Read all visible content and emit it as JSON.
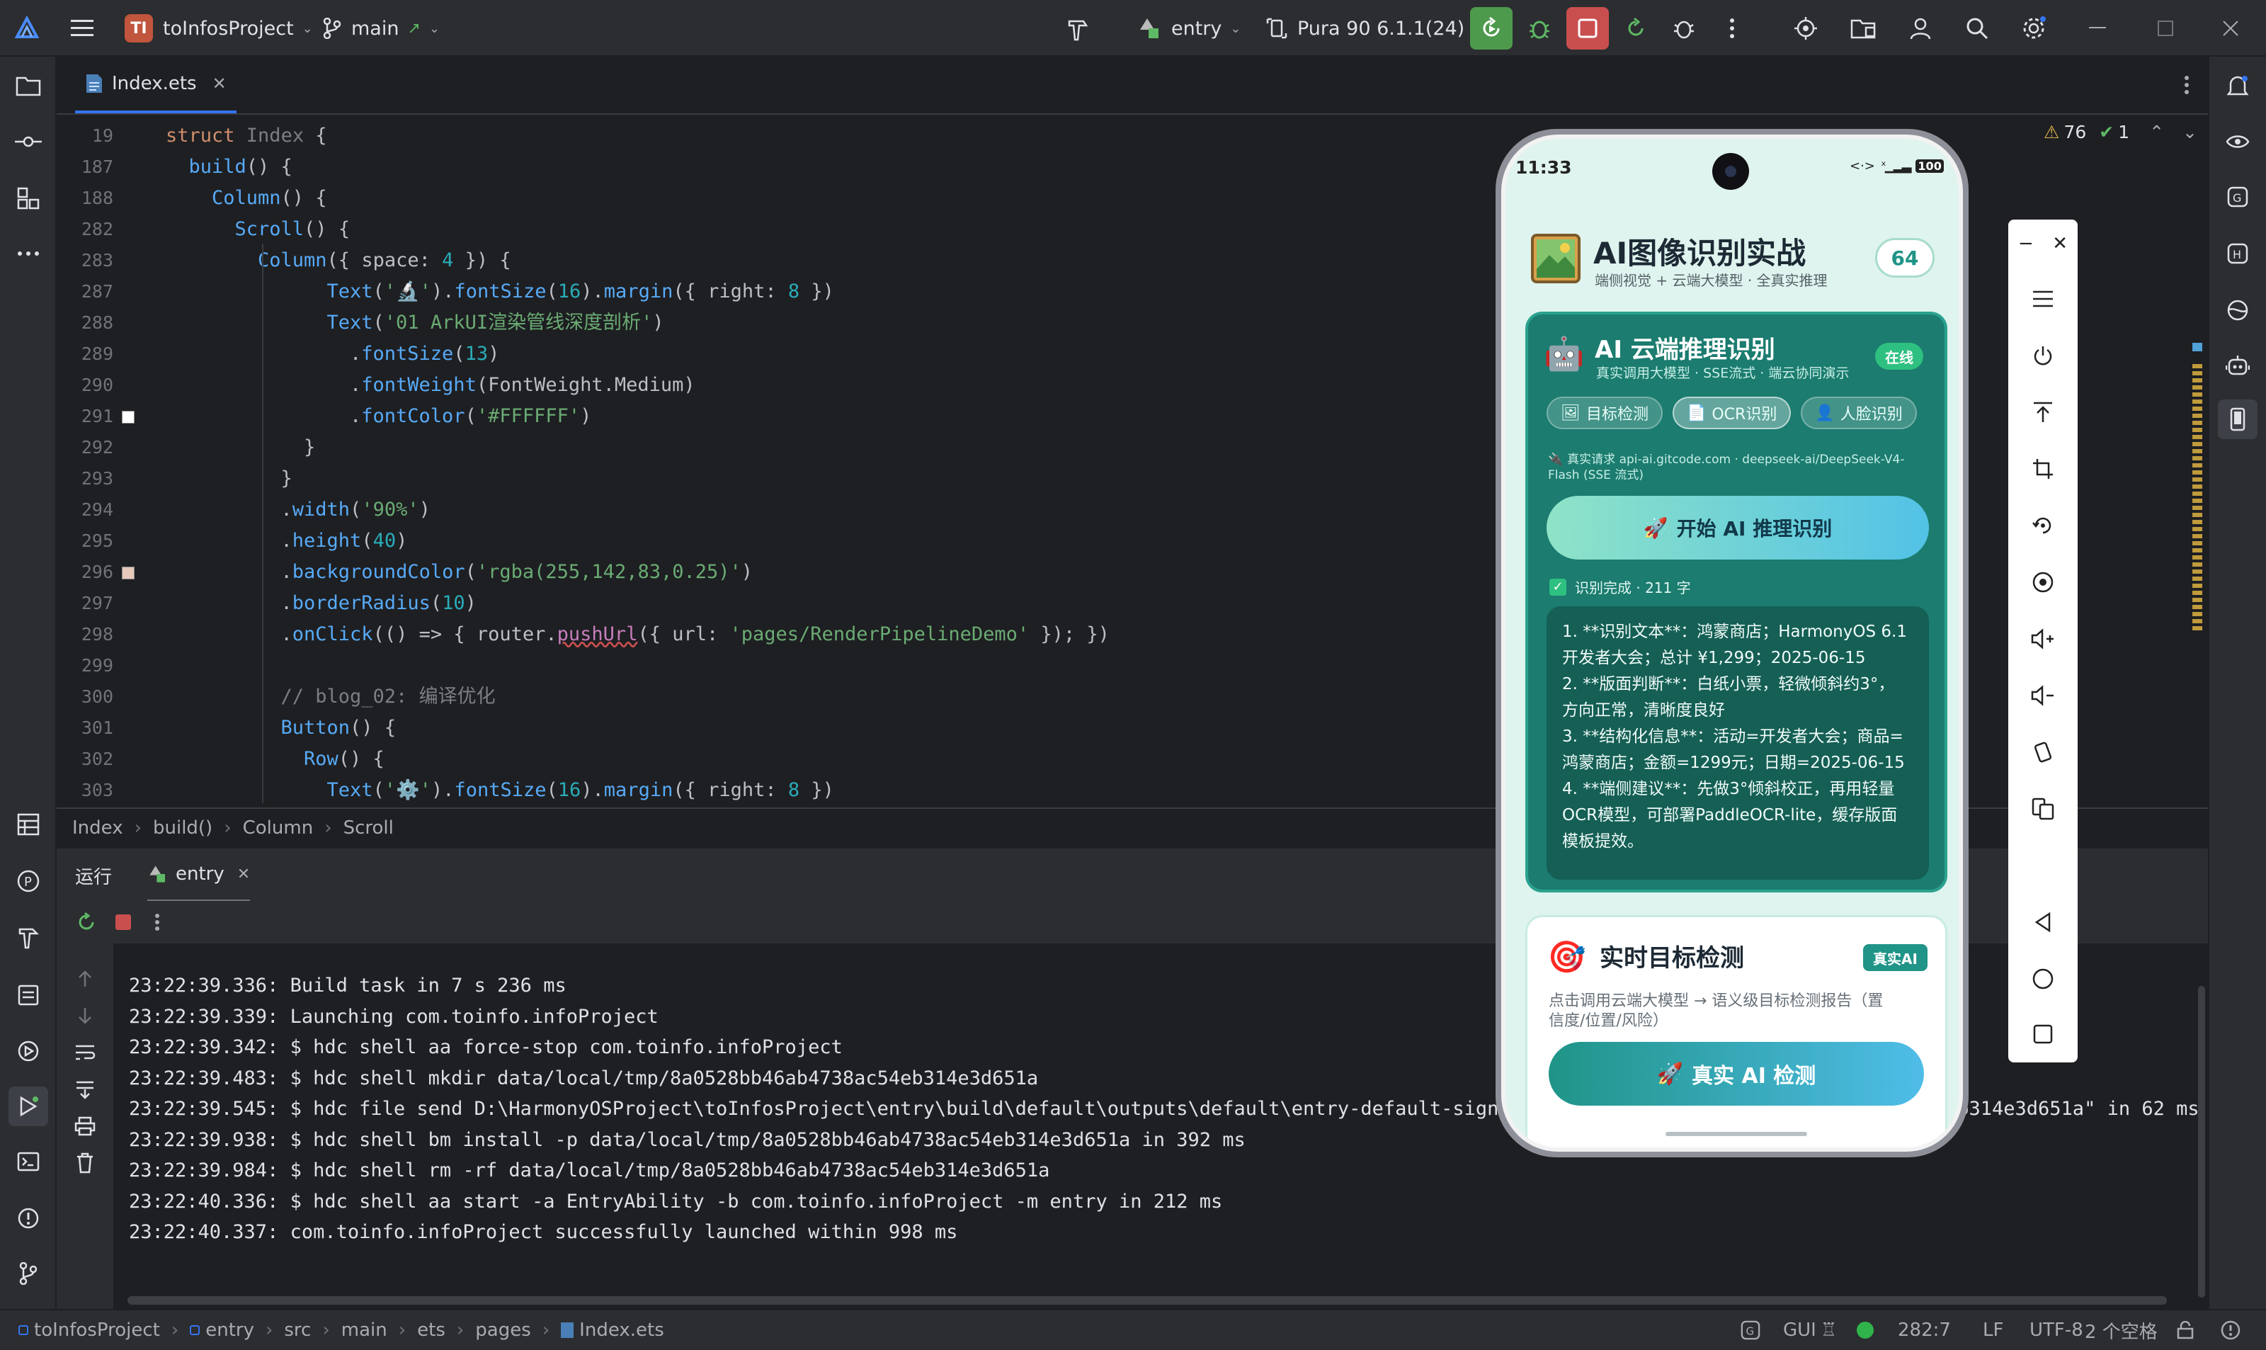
{
  "topbar": {
    "project_badge": "TI",
    "project": "toInfosProject",
    "branch": "main",
    "run_config": "entry",
    "device": "Pura 90 6.1.1(24)"
  },
  "tabs": {
    "file": "Index.ets"
  },
  "editor": {
    "warnings": "76",
    "checks": "1",
    "lines": [
      {
        "n": "19",
        "indent": 0,
        "guide": false,
        "parts": [
          [
            "kw",
            "struct "
          ],
          [
            "cm",
            "Index"
          ],
          [
            "cls",
            " {"
          ]
        ]
      },
      {
        "n": "187",
        "indent": 1,
        "guide": false,
        "parts": [
          [
            "fn",
            "build"
          ],
          [
            "cls",
            "() {"
          ]
        ]
      },
      {
        "n": "188",
        "indent": 2,
        "guide": false,
        "parts": [
          [
            "fn",
            "Column"
          ],
          [
            "cls",
            "() {"
          ]
        ]
      },
      {
        "n": "282",
        "indent": 3,
        "guide": false,
        "parts": [
          [
            "fn",
            "Scroll"
          ],
          [
            "cls",
            "() {"
          ]
        ]
      },
      {
        "n": "283",
        "indent": 4,
        "guide": false,
        "parts": [
          [
            "fn",
            "Column"
          ],
          [
            "cls",
            "({ space: "
          ],
          [
            "nm",
            "4"
          ],
          [
            "cls",
            " }) {"
          ]
        ]
      },
      {
        "n": "287",
        "indent": 7,
        "guide": false,
        "parts": [
          [
            "fn",
            "Text"
          ],
          [
            "cls",
            "("
          ],
          [
            "st",
            "'🔬'"
          ],
          [
            "cls",
            ")."
          ],
          [
            "fn",
            "fontSize"
          ],
          [
            "cls",
            "("
          ],
          [
            "nm",
            "16"
          ],
          [
            "cls",
            ")."
          ],
          [
            "fn",
            "margin"
          ],
          [
            "cls",
            "({ right: "
          ],
          [
            "nm",
            "8"
          ],
          [
            "cls",
            " })"
          ]
        ]
      },
      {
        "n": "288",
        "indent": 7,
        "guide": false,
        "parts": [
          [
            "fn",
            "Text"
          ],
          [
            "cls",
            "("
          ],
          [
            "st",
            "'01 ArkUI渲染管线深度剖析'"
          ],
          [
            "cls",
            ")"
          ]
        ]
      },
      {
        "n": "289",
        "indent": 8,
        "guide": false,
        "parts": [
          [
            "cls",
            "."
          ],
          [
            "fn",
            "fontSize"
          ],
          [
            "cls",
            "("
          ],
          [
            "nm",
            "13"
          ],
          [
            "cls",
            ")"
          ]
        ]
      },
      {
        "n": "290",
        "indent": 8,
        "guide": false,
        "parts": [
          [
            "cls",
            "."
          ],
          [
            "fn",
            "fontWeight"
          ],
          [
            "cls",
            "(FontWeight.Medium)"
          ]
        ]
      },
      {
        "n": "291",
        "indent": 8,
        "guide": true,
        "swatch": "#FFFFFF",
        "parts": [
          [
            "cls",
            "."
          ],
          [
            "fn",
            "fontColor"
          ],
          [
            "cls",
            "("
          ],
          [
            "st",
            "'#FFFFFF'"
          ],
          [
            "cls",
            ")"
          ]
        ]
      },
      {
        "n": "292",
        "indent": 6,
        "guide": false,
        "parts": [
          [
            "cls",
            "}"
          ]
        ]
      },
      {
        "n": "293",
        "indent": 5,
        "guide": false,
        "parts": [
          [
            "cls",
            "}"
          ]
        ]
      },
      {
        "n": "294",
        "indent": 5,
        "guide": false,
        "parts": [
          [
            "cls",
            "."
          ],
          [
            "fn",
            "width"
          ],
          [
            "cls",
            "("
          ],
          [
            "st",
            "'90%'"
          ],
          [
            "cls",
            ")"
          ]
        ]
      },
      {
        "n": "295",
        "indent": 5,
        "guide": false,
        "parts": [
          [
            "cls",
            "."
          ],
          [
            "fn",
            "height"
          ],
          [
            "cls",
            "("
          ],
          [
            "nm",
            "40"
          ],
          [
            "cls",
            ")"
          ]
        ]
      },
      {
        "n": "296",
        "indent": 5,
        "guide": true,
        "swatch": "#e6c9bb",
        "parts": [
          [
            "cls",
            "."
          ],
          [
            "fn",
            "backgroundColor"
          ],
          [
            "cls",
            "("
          ],
          [
            "st",
            "'rgba(255,142,83,0.25)'"
          ],
          [
            "cls",
            ")"
          ]
        ]
      },
      {
        "n": "297",
        "indent": 5,
        "guide": false,
        "parts": [
          [
            "cls",
            "."
          ],
          [
            "fn",
            "borderRadius"
          ],
          [
            "cls",
            "("
          ],
          [
            "nm",
            "10"
          ],
          [
            "cls",
            ")"
          ]
        ]
      },
      {
        "n": "298",
        "indent": 5,
        "guide": false,
        "parts": [
          [
            "cls",
            "."
          ],
          [
            "fn",
            "onClick"
          ],
          [
            "cls",
            "(() => { router."
          ],
          [
            "pr",
            "pushUrl"
          ],
          [
            "cls",
            "({ url: "
          ],
          [
            "st",
            "'pages/RenderPipelineDemo'"
          ],
          [
            "cls",
            " }); })"
          ]
        ]
      },
      {
        "n": "299",
        "indent": 5,
        "guide": false,
        "parts": []
      },
      {
        "n": "300",
        "indent": 5,
        "guide": false,
        "parts": [
          [
            "cm",
            "// blog_02: 编译优化"
          ]
        ]
      },
      {
        "n": "301",
        "indent": 5,
        "guide": false,
        "parts": [
          [
            "fn",
            "Button"
          ],
          [
            "cls",
            "() {"
          ]
        ]
      },
      {
        "n": "302",
        "indent": 6,
        "guide": false,
        "parts": [
          [
            "fn",
            "Row"
          ],
          [
            "cls",
            "() {"
          ]
        ]
      },
      {
        "n": "303",
        "indent": 7,
        "guide": false,
        "parts": [
          [
            "fn",
            "Text"
          ],
          [
            "cls",
            "("
          ],
          [
            "st",
            "'⚙️'"
          ],
          [
            "cls",
            ")."
          ],
          [
            "fn",
            "fontSize"
          ],
          [
            "cls",
            "("
          ],
          [
            "nm",
            "16"
          ],
          [
            "cls",
            ")."
          ],
          [
            "fn",
            "margin"
          ],
          [
            "cls",
            "({ right: "
          ],
          [
            "nm",
            "8"
          ],
          [
            "cls",
            " })"
          ]
        ]
      }
    ]
  },
  "breadcrumb": [
    "Index",
    "build()",
    "Column",
    "Scroll"
  ],
  "run": {
    "tab_run": "运行",
    "tab_entry": "entry",
    "lines": [
      "23:22:39.336: Build task in 7 s 236 ms",
      "23:22:39.339: Launching com.toinfo.infoProject",
      "23:22:39.342: $ hdc shell aa force-stop com.toinfo.infoProject",
      "23:22:39.483: $ hdc shell mkdir data/local/tmp/8a0528bb46ab4738ac54eb314e3d651a",
      "23:22:39.545: $ hdc file send D:\\HarmonyOSProject\\toInfosProject\\entry\\build\\default\\outputs\\default\\entry-default-signed",
      "23:22:39.938: $ hdc shell bm install -p data/local/tmp/8a0528bb46ab4738ac54eb314e3d651a in 392 ms",
      "23:22:39.984: $ hdc shell rm -rf data/local/tmp/8a0528bb46ab4738ac54eb314e3d651a",
      "23:22:40.336: $ hdc shell aa start -a EntryAbility -b com.toinfo.infoProject -m entry in 212 ms",
      "23:22:40.337: com.toinfo.infoProject successfully launched within 998 ms"
    ],
    "line5_tail": "eb314e3d651a\" in 62 ms"
  },
  "status": {
    "path": [
      "toInfosProject",
      "entry",
      "src",
      "main",
      "ets",
      "pages",
      "Index.ets"
    ],
    "gui": "GUI",
    "position": "282:7",
    "line_sep": "LF",
    "encoding": "UTF-8",
    "indent": "2 个空格"
  },
  "phone": {
    "time": "11:33",
    "battery": "100",
    "app_title": "AI图像识别实战",
    "app_subtitle": "端侧视觉 + 云端大模型 · 全真实推理",
    "score": "64",
    "cloud": {
      "title": "AI 云端推理识别",
      "subtitle": "真实调用大模型 · SSE流式 · 端云协同演示",
      "online": "在线",
      "chips": [
        "目标检测",
        "OCR识别",
        "人脸识别"
      ],
      "request": "真实请求 api-ai.gitcode.com · deepseek-ai/DeepSeek-V4-Flash (SSE 流式)",
      "button": "开始 AI 推理识别",
      "done": "识别完成 · 211 字",
      "result": [
        "1. **识别文本**：鸿蒙商店；HarmonyOS 6.1",
        "开发者大会；总计 ¥1,299；2025-06-15",
        "2. **版面判断**：白纸小票，轻微倾斜约3°，",
        "方向正常，清晰度良好",
        "3. **结构化信息**：活动=开发者大会；商品=",
        "鸿蒙商店；金额=1299元；日期=2025-06-15",
        "4. **端侧建议**：先做3°倾斜校正，再用轻量",
        "OCR模型，可部署PaddleOCR-lite，缓存版面",
        "模板提效。"
      ]
    },
    "detect": {
      "title": "实时目标检测",
      "badge": "真实AI",
      "desc1": "点击调用云端大模型 → 语义级目标检测报告（置",
      "desc2": "信度/位置/风险）",
      "button": "真实 AI 检测"
    }
  },
  "colors": {
    "accent": "#3574f0",
    "run_green": "#4e9a4c",
    "stop_red": "#c94f4f",
    "teal": "#1f9487",
    "phone_bg": "#dff4ee"
  }
}
